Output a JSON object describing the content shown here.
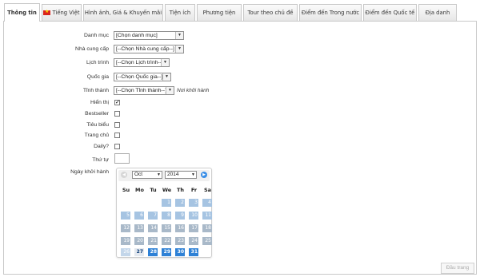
{
  "tabs": [
    {
      "label": "Thông tin",
      "active": true
    },
    {
      "label": "Tiếng Việt",
      "flag": true
    },
    {
      "label": "Hình ảnh, Giá & Khuyến mãi"
    },
    {
      "label": "Tiện ích"
    },
    {
      "label": "Phương tiện"
    },
    {
      "label": "Tour theo chủ đề"
    },
    {
      "label": "Điểm đến Trong nước"
    },
    {
      "label": "Điểm đến Quốc tế"
    },
    {
      "label": "Địa danh"
    }
  ],
  "form": {
    "category_label": "Danh mục",
    "category_value": "[Chọn danh mục]",
    "supplier_label": "Nhà cung cấp",
    "supplier_value": "[--Chọn Nhà cung cấp--]",
    "itinerary_label": "Lịch trình",
    "itinerary_value": "[--Chọn Lịch trình--]",
    "country_label": "Quốc gia",
    "country_value": "[--Chọn Quốc gia--]",
    "province_label": "Tỉnh thành",
    "province_value": "[--Chọn Tỉnh thành--]",
    "province_note": "Nơi khởi hành",
    "show_label": "Hiển thị",
    "show_checked": true,
    "bestseller_label": "Bestseller",
    "featured_label": "Tiêu biểu",
    "homepage_label": "Trang chủ",
    "daily_label": "Daily?",
    "order_label": "Thứ tự",
    "start_date_label": "Ngày khởi hành"
  },
  "calendar": {
    "month": "Oct",
    "year": "2014",
    "weekdays": [
      "Su",
      "Mo",
      "Tu",
      "We",
      "Th",
      "Fr",
      "Sa"
    ],
    "rows": [
      [
        null,
        null,
        null,
        "1",
        "2",
        "3",
        "4"
      ],
      [
        "5",
        "6",
        "7",
        "8",
        "9",
        "10",
        "11"
      ],
      [
        "12",
        "13",
        "14",
        "15",
        "16",
        "17",
        "18"
      ],
      [
        "19",
        "20",
        "21",
        "22",
        "23",
        "24",
        "25"
      ],
      [
        "26",
        "27",
        "28",
        "29",
        "30",
        "31",
        null
      ]
    ]
  },
  "buttons": {
    "next_label": "Đầu trang"
  }
}
